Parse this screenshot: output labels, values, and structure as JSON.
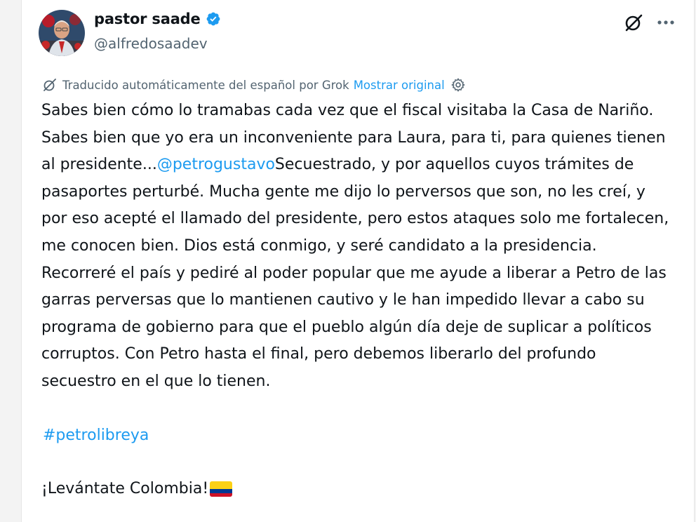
{
  "user": {
    "display_name": "pastor saade",
    "handle": "@alfredosaadev",
    "verified": true,
    "verified_color": "#1d9bf0"
  },
  "header_icons": [
    "grok-icon",
    "more-options-icon"
  ],
  "translation": {
    "notice": "Traducido automáticamente del español por Grok",
    "show_original": "Mostrar original",
    "icons": [
      "translate-icon",
      "gear-icon"
    ]
  },
  "tweet": {
    "text_part1": "Sabes bien cómo lo tramabas cada vez que el fiscal visitaba la Casa de Nariño. Sabes bien que yo era un inconveniente para Laura, para ti, para quienes tienen al presidente...",
    "mention": "@petrogustavo",
    "text_part2": "Secuestrado, y por aquellos cuyos trámites de pasaportes perturbé. Mucha gente me dijo lo perversos que son, no les creí, y por eso acepté el llamado del presidente, pero estos ataques solo me fortalecen, me conocen bien. Dios está conmigo, y seré candidato a la presidencia. Recorreré el país y pediré al poder popular que me ayude a liberar a Petro de las garras perversas que lo mantienen cautivo y le han impedido llevar a cabo su programa de gobierno para que el pueblo algún día deje de suplicar a políticos corruptos. Con Petro hasta el final, pero debemos liberarlo del profundo secuestro en el que lo tienen.",
    "hashtag": "#petrolibreya",
    "closing": "¡Levántate Colombia!",
    "closing_emoji": "colombia-flag"
  },
  "colors": {
    "link": "#1d9bf0",
    "secondary_text": "#536471",
    "primary_text": "#0f1419"
  }
}
